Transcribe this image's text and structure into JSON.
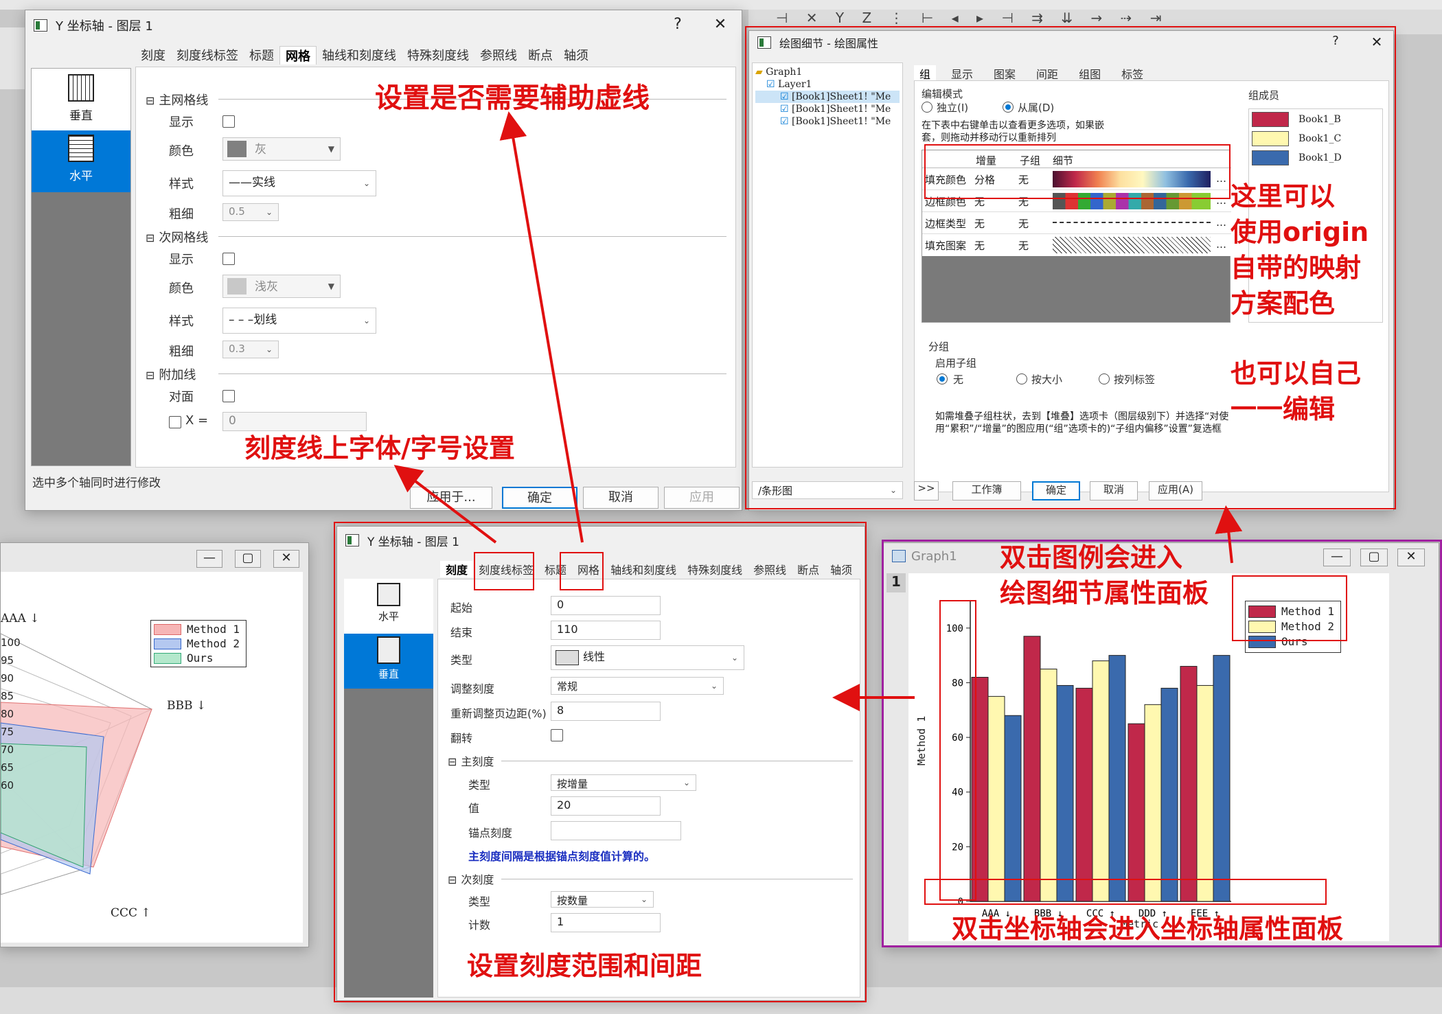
{
  "top_window": {
    "title": "Y 坐标轴 - 图层 1",
    "help": "?",
    "close": "✕",
    "tabs": [
      "刻度",
      "刻度线标签",
      "标题",
      "网格",
      "轴线和刻度线",
      "特殊刻度线",
      "参照线",
      "断点",
      "轴须"
    ],
    "active_tab": "网格",
    "sidebar": [
      "垂直",
      "水平"
    ],
    "major_grid": {
      "header": "主网格线",
      "show": "显示",
      "color": "颜色",
      "color_value": "灰",
      "style": "样式",
      "style_value": "——实线",
      "width": "粗细",
      "width_value": "0.5"
    },
    "minor_grid": {
      "header": "次网格线",
      "show": "显示",
      "color": "颜色",
      "color_value": "浅灰",
      "style": "样式",
      "style_value": "– – –划线",
      "width": "粗细",
      "width_value": "0.3"
    },
    "extra": {
      "header": "附加线",
      "opposite": "对面",
      "x_label": "X =",
      "x_value": "0"
    },
    "status": "选中多个轴同时进行修改",
    "buttons": [
      "应用于...",
      "确定",
      "取消",
      "应用"
    ]
  },
  "plot_details": {
    "title": "绘图细节 - 绘图属性",
    "help": "?",
    "close": "✕",
    "tree": [
      "Graph1",
      "Layer1",
      "[Book1]Sheet1! \"Me",
      "[Book1]Sheet1! \"Me",
      "[Book1]Sheet1! \"Me"
    ],
    "tabs": [
      "组",
      "显示",
      "图案",
      "间距",
      "组图",
      "标签"
    ],
    "edit_mode": "编辑模式",
    "independent": "独立(I)",
    "dependent": "从属(D)",
    "members_label": "组成员",
    "members": [
      "Book1_B",
      "Book1_C",
      "Book1_D"
    ],
    "member_colors": [
      "#c0284a",
      "#fff8b0",
      "#3a6aad"
    ],
    "hint": "在下表中右键单击以查看更多选项，如果嵌套，则拖动并移动行以重新排列",
    "table_headers": [
      "增量",
      "子组",
      "细节"
    ],
    "rows": [
      {
        "name": "填充颜色",
        "inc": "分格",
        "sub": "无"
      },
      {
        "name": "边框颜色",
        "inc": "无",
        "sub": "无"
      },
      {
        "name": "边框类型",
        "inc": "无",
        "sub": "无"
      },
      {
        "name": "填充图案",
        "inc": "无",
        "sub": "无"
      }
    ],
    "group_title": "分组",
    "enable_sub": "启用子组",
    "sub_opts": [
      "无",
      "按大小",
      "按列标签"
    ],
    "note": "如需堆叠子组柱状，去到【堆叠】选项卡（图层级别下）并选择“对使用“累积”/“增量”的图应用(“组”选项卡的)“子组内偏移”设置”复选框",
    "footer_select": "/条形图",
    "footer_buttons": [
      ">>",
      "工作簿",
      "确定",
      "取消",
      "应用(A)"
    ]
  },
  "bottom_window": {
    "title": "Y 坐标轴 - 图层 1",
    "tabs": [
      "刻度",
      "刻度线标签",
      "标题",
      "网格",
      "轴线和刻度线",
      "特殊刻度线",
      "参照线",
      "断点",
      "轴须"
    ],
    "active_tab": "刻度",
    "sidebar": [
      "水平",
      "垂直"
    ],
    "from": "起始",
    "from_val": "0",
    "to": "结束",
    "to_val": "110",
    "type": "类型",
    "type_val": "线性",
    "rescale": "调整刻度",
    "rescale_val": "常规",
    "margin": "重新调整页边距(%)",
    "margin_val": "8",
    "flip": "翻转",
    "major": "主刻度",
    "major_type": "类型",
    "major_type_val": "按增量",
    "major_value": "值",
    "major_value_val": "20",
    "anchor": "锚点刻度",
    "major_note": "主刻度间隔是根据锚点刻度值计算的。",
    "minor": "次刻度",
    "minor_type": "类型",
    "minor_type_val": "按数量",
    "count": "计数",
    "count_val": "1"
  },
  "radar": {
    "legend": [
      "Method 1",
      "Method 2",
      "Ours"
    ],
    "legend_colors": [
      "#f6b6b6",
      "#b4c8f0",
      "#b4e8cc"
    ],
    "axis_labels": [
      "AAA ↓",
      "BBB ↓",
      "CCC ↑"
    ],
    "ticks": [
      "100",
      "95",
      "90",
      "85",
      "80",
      "75",
      "70",
      "65",
      "60"
    ]
  },
  "graph1": {
    "title": "Graph1",
    "layer": "1",
    "legend": [
      "Method 1",
      "Method 2",
      "Ours"
    ],
    "colors": [
      "#c0284a",
      "#fff8b0",
      "#3a6aad"
    ],
    "ylabel": "Method 1",
    "xlabel": "Metric",
    "yticks": [
      "0",
      "20",
      "40",
      "60",
      "80",
      "100"
    ]
  },
  "chart_data": {
    "type": "bar",
    "categories": [
      "AAA ↓",
      "BBB ↓",
      "CCC ↑",
      "DDD ↑",
      "EEE ↑"
    ],
    "series": [
      {
        "name": "Method 1",
        "values": [
          82,
          97,
          78,
          65,
          86
        ]
      },
      {
        "name": "Method 2",
        "values": [
          75,
          85,
          88,
          72,
          79
        ]
      },
      {
        "name": "Ours",
        "values": [
          68,
          79,
          90,
          78,
          90
        ]
      }
    ],
    "xlabel": "Metric",
    "ylabel": "Method 1",
    "ylim": [
      0,
      110
    ]
  },
  "annotations": {
    "grid_note": "设置是否需要辅助虚线",
    "font_note": "刻度线上字体/字号设置",
    "range_note": "设置刻度范围和间距",
    "colormap_note": "这里可以\n使用origin\n自带的映射\n方案配色",
    "manual_note": "也可以自己\n一一编辑",
    "legend_note": "双击图例会进入\n绘图细节属性面板",
    "axis_note": "双击坐标轴会进入坐标轴属性面板"
  }
}
